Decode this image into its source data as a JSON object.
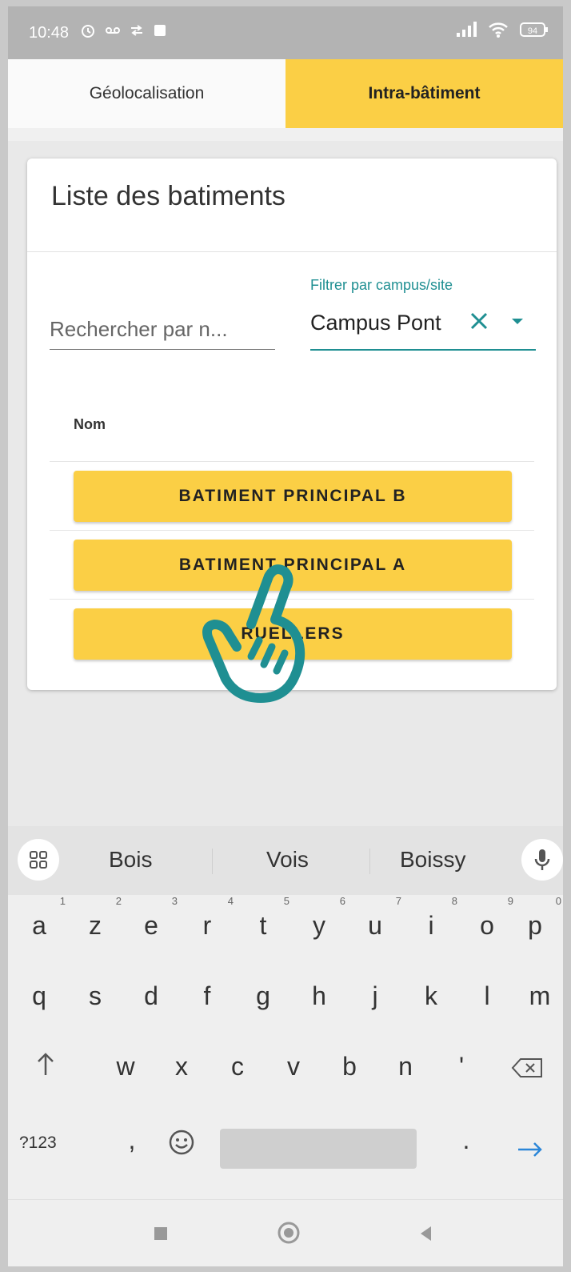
{
  "status_bar": {
    "time": "10:48",
    "battery": "94"
  },
  "tabs": [
    {
      "label": "Géolocalisation",
      "active": false
    },
    {
      "label": "Intra-bâtiment",
      "active": true
    }
  ],
  "card": {
    "title": "Liste des batiments",
    "search": {
      "placeholder": "Rechercher par n..."
    },
    "filter": {
      "label": "Filtrer par campus/site",
      "value": "Campus Pont"
    },
    "column_header": "Nom",
    "buildings": [
      "BATIMENT PRINCIPAL B",
      "BATIMENT PRINCIPAL A",
      "RUELLERS"
    ]
  },
  "keyboard": {
    "suggestions": [
      "Bois",
      "Vois",
      "Boissy"
    ],
    "row1": [
      "a",
      "z",
      "e",
      "r",
      "t",
      "y",
      "u",
      "i",
      "o",
      "p"
    ],
    "row1_hints": [
      "1",
      "2",
      "3",
      "4",
      "5",
      "6",
      "7",
      "8",
      "9",
      "0"
    ],
    "row2": [
      "q",
      "s",
      "d",
      "f",
      "g",
      "h",
      "j",
      "k",
      "l",
      "m"
    ],
    "row3": [
      "w",
      "x",
      "c",
      "v",
      "b",
      "n",
      "'"
    ],
    "symbols_key": "?123",
    "comma": ",",
    "period": "."
  },
  "colors": {
    "accent": "#fbcf45",
    "teal": "#1f8f92"
  }
}
